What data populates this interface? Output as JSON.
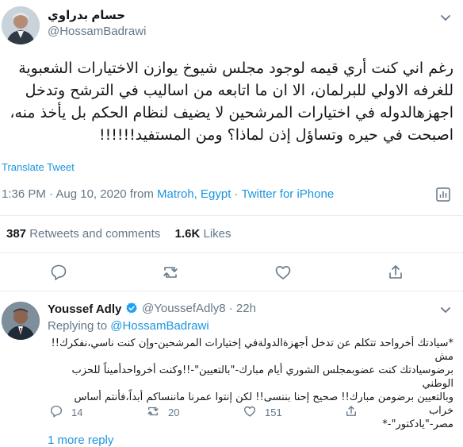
{
  "tweet": {
    "author_name": "حسام بدراوي",
    "author_handle": "@HossamBadrawi",
    "text_lines": [
      "رغم اني كنت أري قيمه لوجود مجلس شيوخ يوازن الاختيارات الشعبوية",
      "للغرفه الاولي للبرلمان، الا ان ما اتابعه من اساليب في الترشح وتدخل",
      "اجهزهالدوله  في اختيارات المرشحين  لا يضيف لنظام الحكم بل يأخذ منه،",
      "اصبحت في حيره وتساؤل  إذن لماذا؟ ومن المستفيد!!!!!!"
    ],
    "translate_label": "Translate Tweet",
    "time": "1:36 PM",
    "date": "Aug 10, 2020",
    "from_label": "from",
    "location": "Matroh, Egypt",
    "source": "Twitter for iPhone",
    "retweets_count": "387",
    "retweets_label": "Retweets and comments",
    "likes_count": "1.6K",
    "likes_label": "Likes"
  },
  "reply": {
    "author_name": "Youssef Adly",
    "author_handle": "@YoussefAdly8",
    "age": "22h",
    "replying_prefix": "Replying to",
    "replying_to": "@HossamBadrawi",
    "text_lines": [
      "*سيادتك أخرواحد تتكلم عن تدخل أجهزةالدولةفي إختيارات المرشحين-وإن كنت ناسي،نفكرك!! مش",
      "برضوسيادتك كنت عضوبمجلس الشوري أيام مبارك-\"بالتعيين\"-!!وكنت أخرواحدأميناً للحزب الوطني",
      "وبالتعيين برضومن مبارك!! صحيح إحنا بننسى!! لكن إنتوا عمرنا ماننساكم أبداً،فأنتم أساس خراب",
      "مصر-\"يادكتور\"-*"
    ],
    "reply_count": "14",
    "retweet_count": "20",
    "like_count": "151",
    "more_replies": "1 more reply"
  },
  "colors": {
    "accent": "#1b95e0",
    "muted": "#657786",
    "divider": "#e6ecf0",
    "verified": "#1da1f2"
  }
}
